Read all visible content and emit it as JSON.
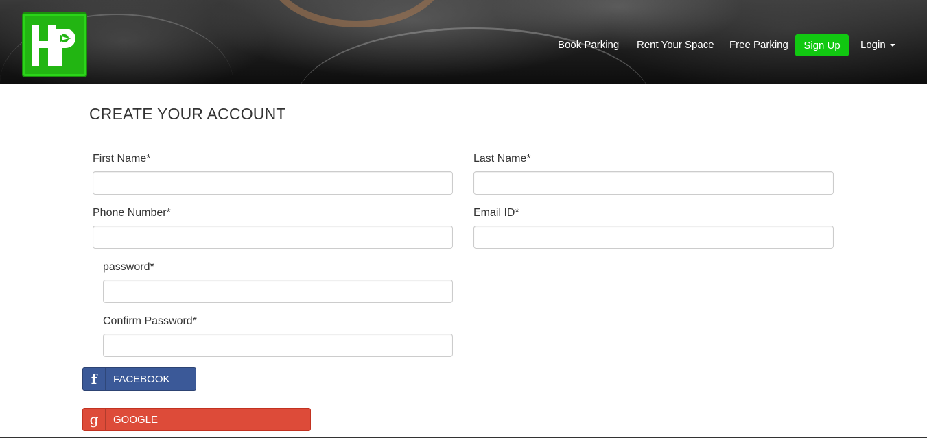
{
  "brand": {
    "logo_text": "HP",
    "logo_color": "#22b512"
  },
  "nav": {
    "links": [
      {
        "label": "Book Parking"
      },
      {
        "label": "Rent Your Space"
      },
      {
        "label": "Free Parking"
      }
    ],
    "signup_label": "Sign Up",
    "login_label": "Login",
    "signup_color": "#11c811"
  },
  "form": {
    "title": "CREATE YOUR ACCOUNT",
    "fields": {
      "first_name": {
        "label": "First Name*",
        "value": ""
      },
      "last_name": {
        "label": "Last Name*",
        "value": ""
      },
      "phone": {
        "label": "Phone Number*",
        "value": ""
      },
      "email": {
        "label": "Email ID*",
        "value": ""
      },
      "password": {
        "label": "password*",
        "value": ""
      },
      "confirm_password": {
        "label": "Confirm Password*",
        "value": ""
      }
    }
  },
  "social": {
    "facebook": {
      "label": "FACEBOOK",
      "icon": "facebook-icon",
      "color": "#3b5998"
    },
    "google": {
      "label": "GOOGLE",
      "icon": "google-icon",
      "color": "#dd4b39"
    }
  }
}
